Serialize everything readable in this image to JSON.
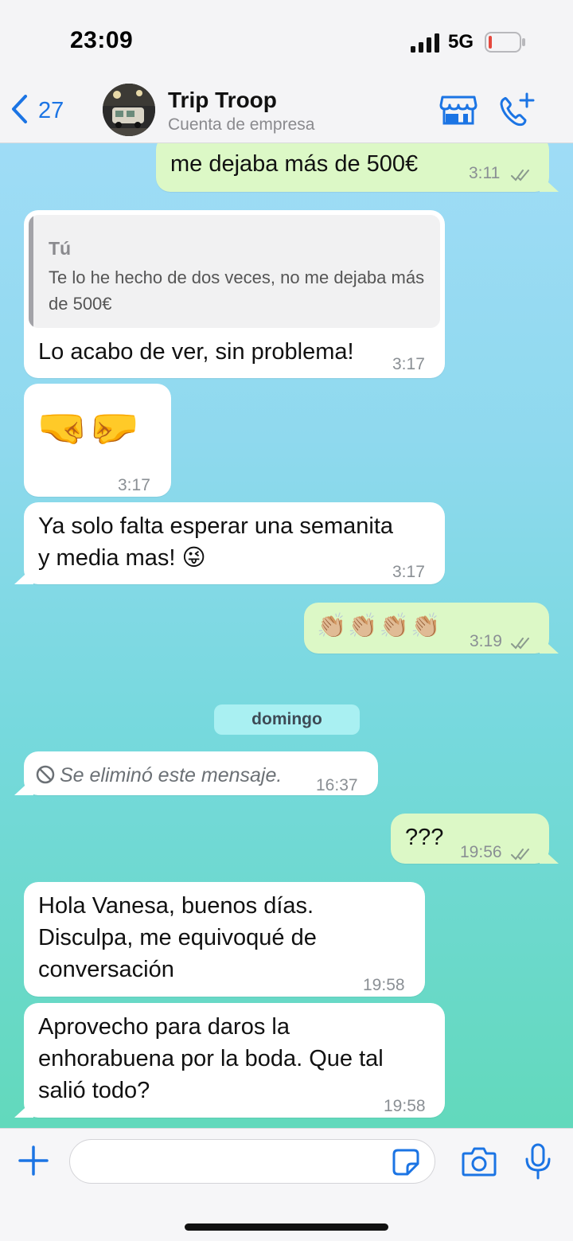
{
  "status_bar": {
    "time": "23:09",
    "network": "5G"
  },
  "header": {
    "back_count": "27",
    "contact_name": "Trip Troop",
    "contact_subtitle": "Cuenta de empresa"
  },
  "messages": [
    {
      "direction": "out",
      "text": "me dejaba más de 500€",
      "time": "3:11",
      "read": true
    },
    {
      "direction": "in",
      "quote_author": "Tú",
      "quote_text": "Te lo he hecho de dos veces, no me dejaba más de 500€",
      "text": "Lo acabo de ver, sin problema!",
      "time": "3:17"
    },
    {
      "direction": "in",
      "text": "🤜🤛",
      "time": "3:17"
    },
    {
      "direction": "in",
      "lines": [
        "Ya solo falta esperar una semanita",
        "y media mas! 😜"
      ],
      "time": "3:17"
    },
    {
      "direction": "out",
      "text": "👏🏼👏🏼👏🏼👏🏼",
      "time": "3:19",
      "read": true
    },
    {
      "direction": "in",
      "deleted": true,
      "text": "Se eliminó este mensaje.",
      "time": "16:37"
    },
    {
      "direction": "out",
      "text": "???",
      "time": "19:56",
      "read": true
    },
    {
      "direction": "in",
      "lines": [
        "Hola Vanesa, buenos días.",
        "Disculpa, me equivoqué de",
        "conversación"
      ],
      "time": "19:58"
    },
    {
      "direction": "in",
      "lines": [
        "Aprovecho para daros la",
        "enhorabuena por la boda. Que tal",
        "salió todo?"
      ],
      "time": "19:58"
    }
  ],
  "day_separator": "domingo",
  "input": {
    "placeholder": ""
  },
  "colors": {
    "accent": "#1b74e4",
    "outgoing_bubble": "#dcf8c6",
    "incoming_bubble": "#ffffff",
    "day_pill": "#a9f0f2"
  },
  "icons": [
    "signal-icon",
    "battery-icon",
    "back-chevron-icon",
    "store-icon",
    "call-add-icon",
    "double-check-icon",
    "blocked-icon",
    "plus-icon",
    "sticker-icon",
    "camera-icon",
    "mic-icon"
  ]
}
